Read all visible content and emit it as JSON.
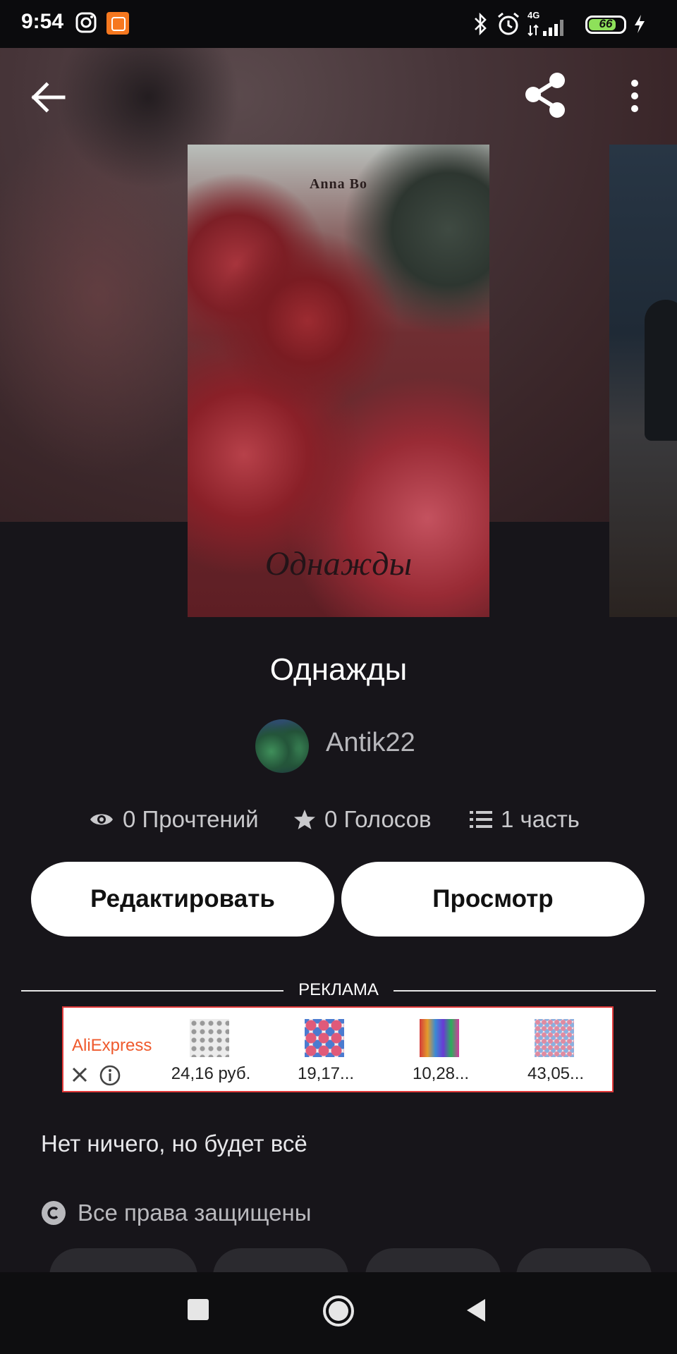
{
  "status_bar": {
    "time": "9:54",
    "battery_percent": "66",
    "network_label": "4G",
    "icons": [
      "instagram-icon",
      "mi-icon",
      "bluetooth-icon",
      "alarm-icon",
      "signal-icon",
      "battery-icon",
      "charging-icon"
    ]
  },
  "toolbar": {
    "back_icon": "arrow-left-icon",
    "share_icon": "share-icon",
    "more_icon": "more-vertical-icon"
  },
  "cover": {
    "author_text": "Anna Bo",
    "title_text": "Однажды"
  },
  "book": {
    "title": "Однажды",
    "author": "Antik22",
    "stats": {
      "reads": "0 Прочтений",
      "votes": "0 Голосов",
      "parts": "1 часть"
    },
    "description": "Нет ничего, но будет всё",
    "copyright": "Все права защищены"
  },
  "actions": {
    "edit_label": "Редактировать",
    "view_label": "Просмотр"
  },
  "ad": {
    "label": "РЕКЛАМА",
    "brand": "AliExpress",
    "products": [
      {
        "price": "24,16 руб."
      },
      {
        "price": "19,17..."
      },
      {
        "price": "10,28..."
      },
      {
        "price": "43,05..."
      }
    ]
  },
  "nav": {
    "items": [
      "recent-apps-icon",
      "home-icon",
      "back-icon"
    ]
  },
  "colors": {
    "background": "#17151a",
    "button_bg": "#ffffff",
    "ad_border": "#e23a3a",
    "ad_brand": "#ef5a2d",
    "battery_fill": "#8ee05a"
  }
}
